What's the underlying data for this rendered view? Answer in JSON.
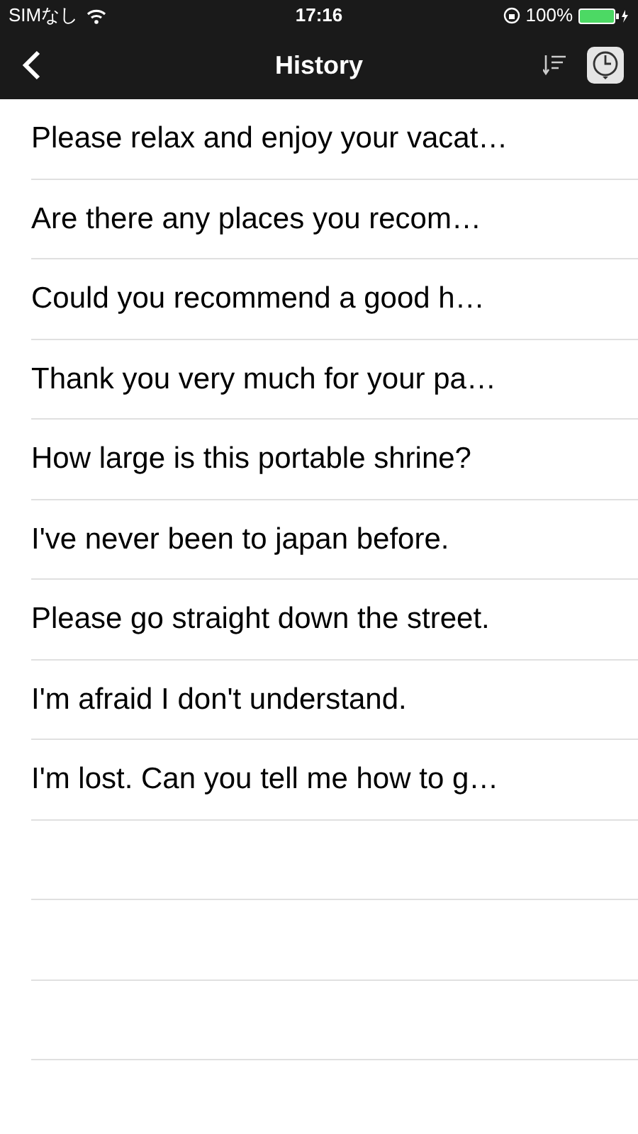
{
  "status_bar": {
    "carrier": "SIMなし",
    "time": "17:16",
    "battery": "100%"
  },
  "nav": {
    "title": "History"
  },
  "items": [
    "Please relax and enjoy your vacat…",
    "Are there any places you recom…",
    "Could you recommend a good h…",
    "Thank you very much for your pa…",
    "How large is this portable shrine?",
    "I've never been to japan before.",
    "Please go straight down the street.",
    "I'm afraid I don't understand.",
    "I'm lost. Can you tell me how to g…"
  ]
}
